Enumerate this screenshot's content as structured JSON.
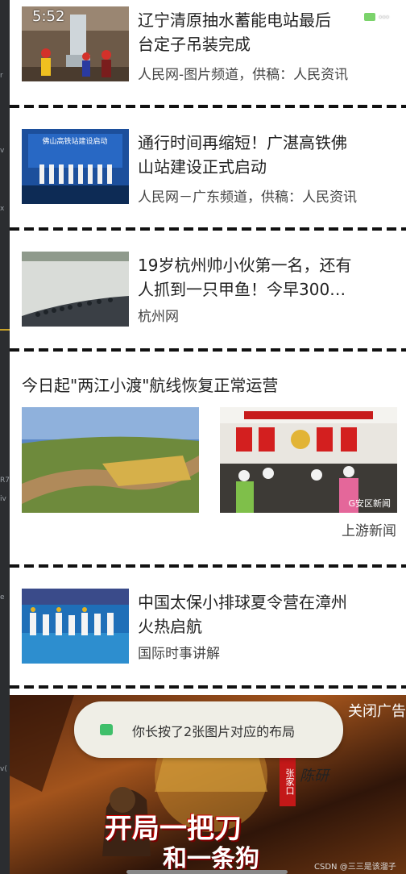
{
  "status_bar": {
    "time": "5:52",
    "dots": "···"
  },
  "ide_strip": {
    "fragments": [
      "r",
      "v",
      "x",
      "R7",
      "iv",
      "e",
      "v("
    ]
  },
  "news": [
    {
      "title": "辽宁清原抽水蓄能电站最后一台定子吊装完成",
      "title_lines": [
        "辽宁清原抽水蓄能电站最后",
        "台定子吊装完成"
      ],
      "source": "人民网-图片频道，供稿：人民资讯"
    },
    {
      "title": "通行时间再缩短！广湛高铁佛山站建设正式启动",
      "title_lines": [
        "通行时间再缩短！广湛高铁佛",
        "山站建设正式启动"
      ],
      "source": "人民网－广东频道，供稿：人民资讯",
      "thumb_caption": "佛山高铁站建设启动"
    },
    {
      "title": "19岁杭州帅小伙第一名，还有人抓到一只甲鱼！今早300…",
      "title_lines": [
        "19岁杭州帅小伙第一名，还有",
        "人抓到一只甲鱼！今早300…"
      ],
      "source": "杭州网"
    }
  ],
  "multi_image": {
    "title": "今日起\"两江小渡\"航线恢复正常运营",
    "source": "上游新闻",
    "image_caption": "G安区新闻"
  },
  "news_last": {
    "title_lines": [
      "中国太保小排球夏令营在漳州",
      "火热启航"
    ],
    "source": "国际时事讲解"
  },
  "ad": {
    "close_label": "关闭广告",
    "line1": "开局一把刀",
    "line2": "和一条狗",
    "stamp": "张家口",
    "signature": "陈研",
    "watermark": "CSDN @三三是该溜子"
  },
  "toast": {
    "text": "你长按了2张图片对应的布局"
  }
}
